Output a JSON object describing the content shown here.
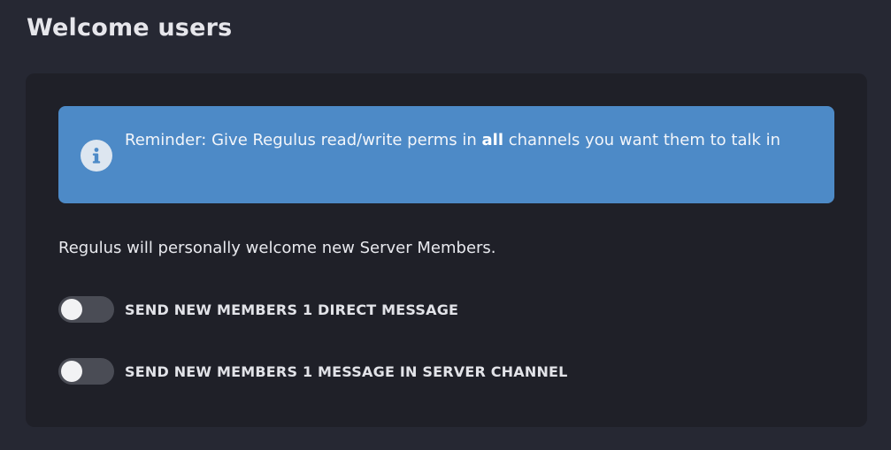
{
  "page": {
    "title": "Welcome users"
  },
  "alert": {
    "icon": "info-icon",
    "text_before": "Reminder: Give Regulus read/write perms in ",
    "text_bold": "all",
    "text_after": " channels you want them to talk in"
  },
  "description": "Regulus will personally welcome new Server Members.",
  "toggles": [
    {
      "label": "SEND NEW MEMBERS 1 DIRECT MESSAGE",
      "enabled": false
    },
    {
      "label": "SEND NEW MEMBERS 1 MESSAGE IN SERVER CHANNEL",
      "enabled": false
    }
  ],
  "colors": {
    "background": "#262833",
    "card": "#1f2028",
    "alert": "#4d8ac7",
    "toggle_off": "#4a4c55"
  }
}
